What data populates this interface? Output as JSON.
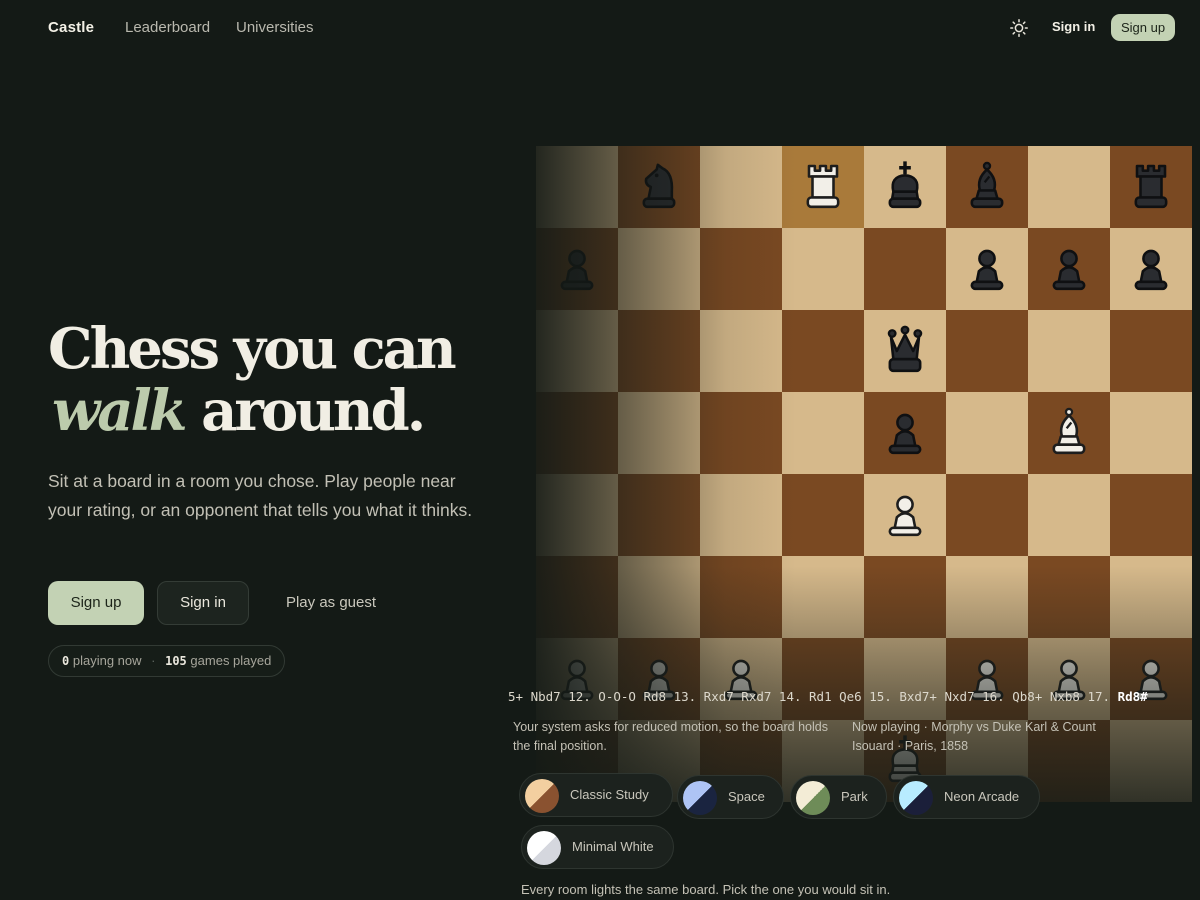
{
  "nav": {
    "brand": "Castle",
    "links": [
      "Leaderboard",
      "Universities"
    ],
    "theme_icon": "sun-icon",
    "sign_in": "Sign in",
    "sign_up": "Sign up"
  },
  "hero": {
    "headline_line1": "Chess you can",
    "headline_em": "walk",
    "headline_rest": "around.",
    "subtitle": "Sit at a board in a room you chose. Play people near your rating, or an opponent that tells you what it thinks.",
    "primary_cta": "Sign up",
    "secondary_cta": "Sign in",
    "guest_cta": "Play as guest",
    "stats": {
      "playing_now": "0",
      "playing_now_label": "playing now",
      "separator": "·",
      "games_played": "105",
      "games_played_label": "games played"
    }
  },
  "board": {
    "light_color": "#d6b98b",
    "dark_color": "#7a4922",
    "highlight_color": "#a97a3a",
    "position": [
      [
        "",
        "bN",
        "",
        "wR",
        "bK",
        "bB",
        "",
        "bR"
      ],
      [
        "bP",
        "",
        "",
        "",
        "",
        "bP",
        "bP",
        "bP"
      ],
      [
        "",
        "",
        "",
        "",
        "bQ",
        "",
        "",
        ""
      ],
      [
        "",
        "",
        "",
        "",
        "bP",
        "",
        "wB",
        ""
      ],
      [
        "",
        "",
        "",
        "",
        "wP",
        "",
        "",
        ""
      ],
      [
        "",
        "",
        "",
        "",
        "",
        "",
        "",
        ""
      ],
      [
        "wP",
        "wP",
        "wP",
        "",
        "",
        "wP",
        "wP",
        "wP"
      ],
      [
        "",
        "",
        "",
        "",
        "wK",
        "",
        "",
        ""
      ]
    ],
    "highlight_squares": [
      "d8"
    ],
    "moves_text": "5+ Nbd7 12. O-O-O Rd8 13. Rxd7 Rxd7 14. Rd1 Qe6 15. Bxd7+ Nxd7 16. Qb8+ Nxb8 17.",
    "last_move": "Rd8#",
    "reduced_motion_note": "Your system asks for reduced motion, so the board holds the final position.",
    "now_playing": "Now playing · Morphy vs Duke Karl & Count Isouard · Paris, 1858"
  },
  "rooms": {
    "items": [
      {
        "label": "Classic Study",
        "swatch_a": "#f3cfa0",
        "swatch_b": "#8a5230",
        "active": true
      },
      {
        "label": "Space",
        "swatch_a": "#aec4f5",
        "swatch_b": "#1a2440",
        "active": false
      },
      {
        "label": "Park",
        "swatch_a": "#f3ecd6",
        "swatch_b": "#6e8c58",
        "active": false
      },
      {
        "label": "Neon Arcade",
        "swatch_a": "#b8ecff",
        "swatch_b": "#1b1f3a",
        "active": false
      },
      {
        "label": "Minimal White",
        "swatch_a": "#ffffff",
        "swatch_b": "#d5d7de",
        "active": false
      }
    ],
    "caption": "Every room lights the same board. Pick the one you would sit in."
  }
}
